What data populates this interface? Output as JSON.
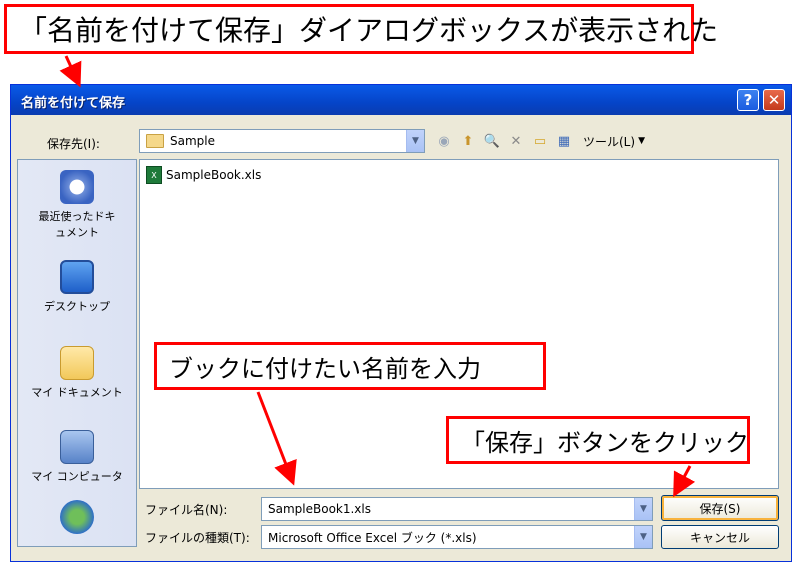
{
  "callouts": {
    "title": "「名前を付けて保存」ダイアログボックスが表示された",
    "name": "ブックに付けたい名前を入力",
    "save": "「保存」ボタンをクリック"
  },
  "dialog": {
    "title": "名前を付けて保存",
    "help": "?",
    "close": "✕",
    "save_in_label": "保存先(I):",
    "save_in_value": "Sample",
    "tools_label": "ツール(L)",
    "places": [
      {
        "label": "最近使ったドキュメント",
        "icon": "recent-documents-icon"
      },
      {
        "label": "デスクトップ",
        "icon": "desktop-icon"
      },
      {
        "label": "マイ ドキュメント",
        "icon": "my-documents-icon"
      },
      {
        "label": "マイ コンピュータ",
        "icon": "my-computer-icon"
      },
      {
        "label": "",
        "icon": "my-network-icon"
      }
    ],
    "files": [
      "SampleBook.xls"
    ],
    "filename_label": "ファイル名(N):",
    "filename_value": "SampleBook1.xls",
    "filetype_label": "ファイルの種類(T):",
    "filetype_value": "Microsoft Office Excel ブック (*.xls)",
    "save_button": "保存(S)",
    "cancel_button": "キャンセル"
  },
  "colors": {
    "callout_border": "#ff0000",
    "titlebar": "#0a5ae8",
    "dialog_bg": "#ece9d8"
  }
}
